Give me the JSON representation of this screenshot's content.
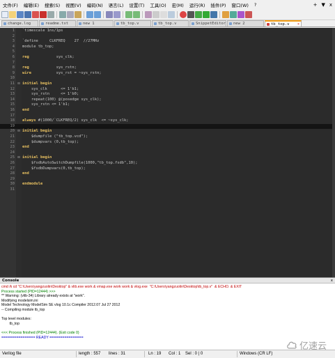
{
  "menu": [
    "文件(F)",
    "编辑(E)",
    "搜索(S)",
    "视图(V)",
    "编码(N)",
    "语言(L)",
    "设置(T)",
    "工具(O)",
    "宏(M)",
    "运行(R)",
    "插件(P)",
    "窗口(W)",
    "?"
  ],
  "window_controls": [
    "+",
    "▼",
    "x"
  ],
  "tabs": [
    {
      "label": "change.log",
      "active": false
    },
    {
      "label": "readme.txt",
      "active": false
    },
    {
      "label": "new 1",
      "active": false
    },
    {
      "label": "tb_top.v",
      "active": false
    },
    {
      "label": "tb_top.v",
      "active": false
    },
    {
      "label": "SnippetEditor_fb",
      "active": false
    },
    {
      "label": "new 2",
      "active": false
    },
    {
      "label": "tb_top.v",
      "active": true
    }
  ],
  "code_lines": [
    {
      "n": "1",
      "fold": "",
      "text": "`timescale 1ns/1ps",
      "kw": ""
    },
    {
      "n": "2",
      "fold": "",
      "text": "",
      "kw": ""
    },
    {
      "n": "3",
      "fold": "",
      "text": "`define     CLKFREQ    27  //27MHz",
      "kw": ""
    },
    {
      "n": "4",
      "fold": "",
      "text": "module tb_top;",
      "kw": ""
    },
    {
      "n": "5",
      "fold": "",
      "text": "",
      "kw": ""
    },
    {
      "n": "6",
      "fold": "",
      "text": "reg            sys_clk;",
      "kw": "reg"
    },
    {
      "n": "7",
      "fold": "",
      "text": "",
      "kw": ""
    },
    {
      "n": "8",
      "fold": "",
      "text": "reg            sys_rstn;",
      "kw": "reg"
    },
    {
      "n": "9",
      "fold": "",
      "text": "wire           sys_rst = ~sys_rstn;",
      "kw": "wire"
    },
    {
      "n": "10",
      "fold": "",
      "text": "",
      "kw": ""
    },
    {
      "n": "11",
      "fold": "⊟",
      "text": "initial begin",
      "kw": "initial begin"
    },
    {
      "n": "12",
      "fold": "",
      "text": "    sys_clk      <= 1'b1;",
      "kw": ""
    },
    {
      "n": "13",
      "fold": "",
      "text": "    sys_rstn     <= 1'b0;",
      "kw": ""
    },
    {
      "n": "14",
      "fold": "",
      "text": "    repeat(100) @(posedge sys_clk);",
      "kw": ""
    },
    {
      "n": "15",
      "fold": "",
      "text": "    sys_rstn <= 1'b1;",
      "kw": ""
    },
    {
      "n": "16",
      "fold": "",
      "text": "end",
      "kw": "end"
    },
    {
      "n": "17",
      "fold": "",
      "text": "",
      "kw": ""
    },
    {
      "n": "18",
      "fold": "",
      "text": "always #(1000/`CLKFREQ/2) sys_clk  <= ~sys_clk;",
      "kw": "always"
    },
    {
      "n": "19",
      "fold": "",
      "text": "",
      "kw": ""
    },
    {
      "n": "20",
      "fold": "⊟",
      "text": "initial begin",
      "kw": "initial begin"
    },
    {
      "n": "21",
      "fold": "",
      "text": "    $dumpfile (\"tb_top.vcd\");",
      "kw": ""
    },
    {
      "n": "22",
      "fold": "",
      "text": "    $dumpvars (0,tb_top);",
      "kw": ""
    },
    {
      "n": "23",
      "fold": "",
      "text": "end",
      "kw": "end"
    },
    {
      "n": "24",
      "fold": "",
      "text": "",
      "kw": ""
    },
    {
      "n": "25",
      "fold": "⊟",
      "text": "initial begin",
      "kw": "initial begin"
    },
    {
      "n": "26",
      "fold": "",
      "text": "    $fsdbAutoSwitchDumpfile(1000,\"tb_top.fsdb\",10);",
      "kw": ""
    },
    {
      "n": "27",
      "fold": "",
      "text": "    $fsdbDumpvars(0,tb_top);",
      "kw": ""
    },
    {
      "n": "28",
      "fold": "",
      "text": "end",
      "kw": "end"
    },
    {
      "n": "29",
      "fold": "",
      "text": "",
      "kw": ""
    },
    {
      "n": "30",
      "fold": "",
      "text": "endmodule",
      "kw": "endmodule"
    },
    {
      "n": "31",
      "fold": "",
      "text": "",
      "kw": ""
    }
  ],
  "current_line": "19",
  "console": {
    "title": "Console",
    "close": "x",
    "lines": [
      {
        "text": "cmd /k cd \"C:\\Users\\yangzuolin\\Desktop\" & vlib.exe work & vmap.exe work work & vlog.exe  \"C:\\Users\\yangzuolin\\Desktop\\tb_top.v\"  & ECHO. & EXIT",
        "color": "red"
      },
      {
        "text": "Process started (PID=12444) >>>",
        "color": "green"
      },
      {
        "text": "** Warning: (vlib-34) Library already exists at \"work\".",
        "color": ""
      },
      {
        "text": "Modifying modelsim.ini",
        "color": ""
      },
      {
        "text": "Model Technology ModelSim SE vlog 10.1c Compiler 2012.07 Jul 27 2012",
        "color": ""
      },
      {
        "text": "-- Compiling module tb_top",
        "color": ""
      },
      {
        "text": "",
        "color": ""
      },
      {
        "text": "Top level modules:",
        "color": ""
      },
      {
        "text": "        tb_top",
        "color": ""
      },
      {
        "text": "",
        "color": ""
      },
      {
        "text": "<<< Process finished (PID=12444). (Exit code 0)",
        "color": "green"
      },
      {
        "text": "================ READY ================",
        "color": "blue"
      }
    ]
  },
  "watermark": "亿速云",
  "status": {
    "lang": "Verilog file",
    "length": "length : 557",
    "lines": "lines : 31",
    "ln": "Ln : 19",
    "col": "Col : 1",
    "sel": "Sel : 0 | 0",
    "eol": "Windows (CR LF)"
  }
}
